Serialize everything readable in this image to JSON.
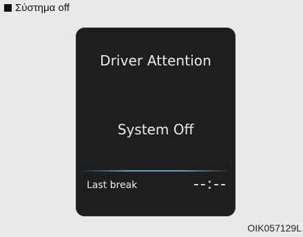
{
  "caption": {
    "icon": "black-square",
    "text": "Σύστημα off"
  },
  "display": {
    "title": "Driver Attention",
    "status": "System Off",
    "last_break_label": "Last break",
    "last_break_value": "--:--",
    "divider_color": "#5d9fce"
  },
  "image_code": "OIK057129L"
}
